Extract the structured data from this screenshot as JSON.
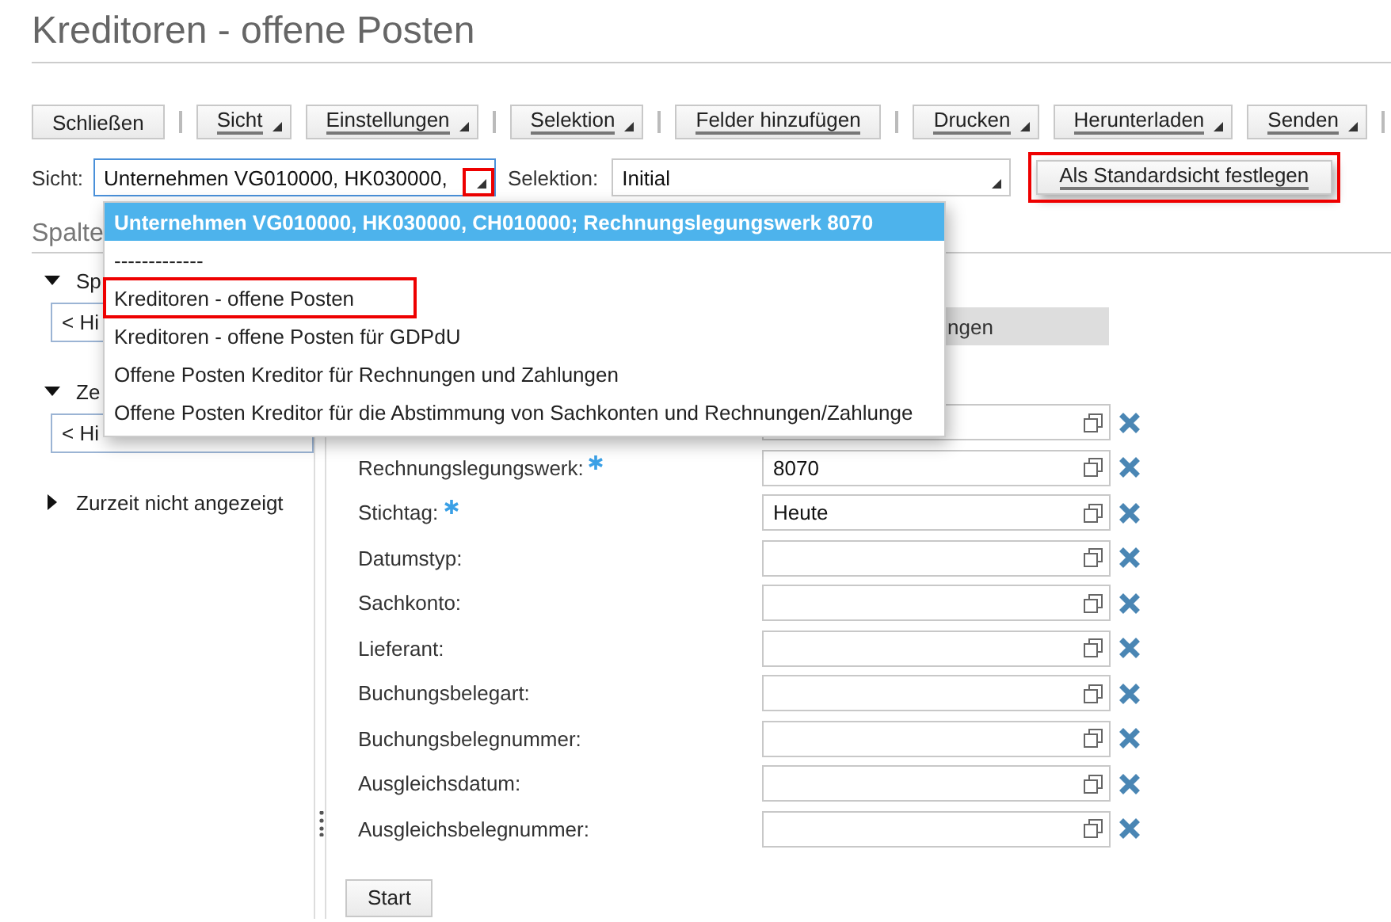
{
  "title": "Kreditoren - offene Posten",
  "toolbar": [
    {
      "label": "Schließen",
      "caret": false,
      "underlined": false,
      "separator_after": true
    },
    {
      "label": "Sicht",
      "caret": true,
      "underlined": true,
      "separator_after": false
    },
    {
      "label": "Einstellungen",
      "caret": true,
      "underlined": true,
      "separator_after": true
    },
    {
      "label": "Selektion",
      "caret": true,
      "underlined": true,
      "separator_after": true
    },
    {
      "label": "Felder hinzufügen",
      "caret": false,
      "underlined": true,
      "separator_after": true
    },
    {
      "label": "Drucken",
      "caret": true,
      "underlined": true,
      "separator_after": false
    },
    {
      "label": "Herunterladen",
      "caret": true,
      "underlined": true,
      "separator_after": false
    },
    {
      "label": "Senden",
      "caret": true,
      "underlined": true,
      "separator_after": true
    }
  ],
  "view_bar": {
    "view_label": "Sicht:",
    "view_value": "Unternehmen VG010000, HK030000,",
    "view_arrow_highlighted": true,
    "selection_label": "Selektion:",
    "selection_value": "Initial",
    "default_button": {
      "label": "Als Standardsicht festlegen",
      "highlighted": true
    }
  },
  "dropdown": [
    {
      "label": "Unternehmen VG010000, HK030000, CH010000; Rechnungslegungswerk 8070",
      "selected": true,
      "highlighted": false
    },
    {
      "label": "-------------",
      "selected": false,
      "highlighted": false
    },
    {
      "label": "Kreditoren - offene Posten",
      "selected": false,
      "highlighted": true
    },
    {
      "label": "Kreditoren - offene Posten für GDPdU",
      "selected": false,
      "highlighted": false
    },
    {
      "label": "Offene Posten Kreditor für Rechnungen und Zahlungen",
      "selected": false,
      "highlighted": false
    },
    {
      "label": "Offene Posten Kreditor für die Abstimmung von Sachkonten und Rechnungen/Zahlunge",
      "selected": false,
      "highlighted": false
    }
  ],
  "section_title": "Spalte",
  "left_panel": [
    {
      "label": "Sp",
      "expanded": true,
      "box": "< Hi"
    },
    {
      "label": "Ze",
      "expanded": true,
      "box": "< Hi"
    },
    {
      "label": "Zurzeit nicht angezeigt",
      "expanded": false
    }
  ],
  "tab": "ngen",
  "form": [
    {
      "kind": "input"
    },
    {
      "kind": "input",
      "label": "Rechnungslegungswerk:",
      "required": true,
      "value": "8070"
    },
    {
      "kind": "input",
      "label": "Stichtag:",
      "required": true,
      "value": "Heute"
    },
    {
      "kind": "input",
      "label": "Datumstyp:",
      "required": false
    },
    {
      "kind": "input",
      "label": "Sachkonto:",
      "required": false
    },
    {
      "kind": "input",
      "label": "Lieferant:",
      "required": false
    },
    {
      "kind": "input",
      "label": "Buchungsbelegart:",
      "required": false
    },
    {
      "kind": "input",
      "label": "Buchungsbelegnummer:",
      "required": false
    },
    {
      "kind": "input",
      "label": "Ausgleichsdatum:",
      "required": false
    },
    {
      "kind": "input",
      "label": "Ausgleichsbelegnummer:",
      "required": false
    }
  ],
  "start_button": "Start"
}
